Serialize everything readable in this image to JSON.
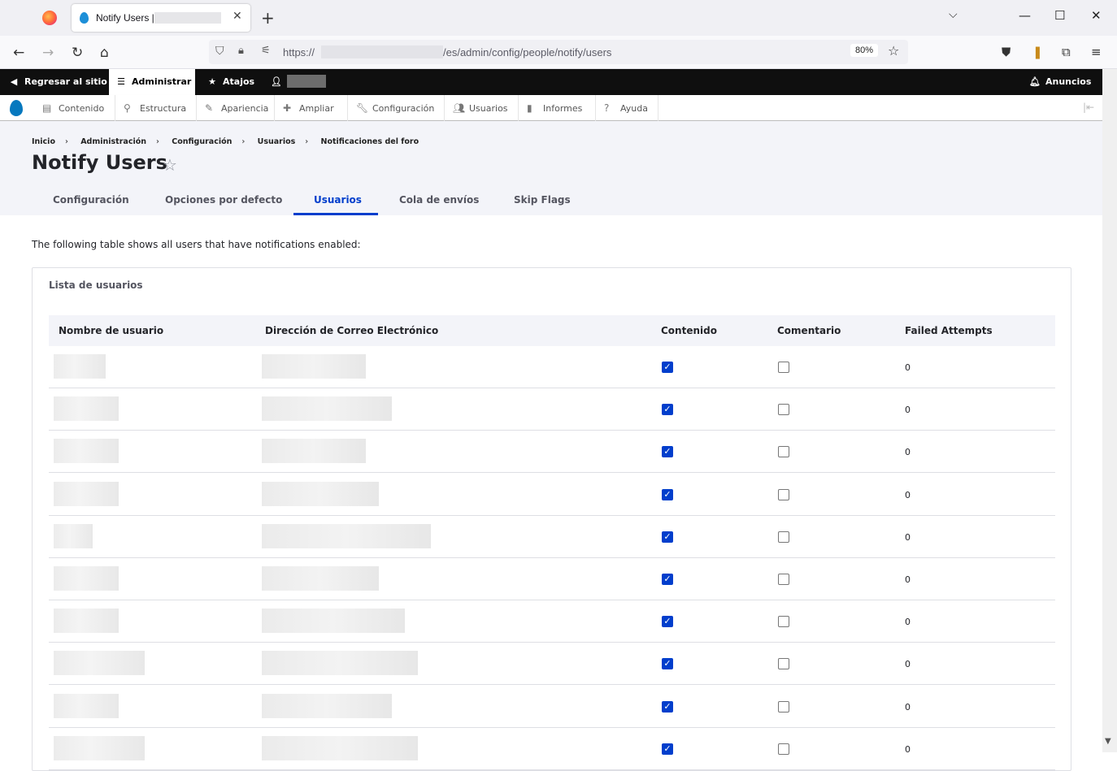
{
  "browser": {
    "tab_title": "Notify Users |",
    "new_tab": "+",
    "url_prefix": "https://",
    "url_path": "/es/admin/config/people/notify/users",
    "zoom": "80%"
  },
  "toolbar": {
    "back_site": "Regresar al sitio",
    "manage": "Administrar",
    "shortcuts": "Atajos",
    "announcements": "Anuncios"
  },
  "tray": {
    "items": [
      "Contenido",
      "Estructura",
      "Apariencia",
      "Ampliar",
      "Configuración",
      "Usuarios",
      "Informes",
      "Ayuda"
    ]
  },
  "breadcrumb": [
    "Inicio",
    "Administración",
    "Configuración",
    "Usuarios",
    "Notificaciones del foro"
  ],
  "page_title": "Notify Users",
  "tabs": [
    "Configuración",
    "Opciones por defecto",
    "Usuarios",
    "Cola de envíos",
    "Skip Flags"
  ],
  "intro": "The following table shows all users that have notifications enabled:",
  "panel_title": "Lista de usuarios",
  "table": {
    "headers": [
      "Nombre de usuario",
      "Dirección de Correo Electrónico",
      "Contenido",
      "Comentario",
      "Failed Attempts"
    ],
    "rows": [
      {
        "contenido": true,
        "comentario": false,
        "failed": "0"
      },
      {
        "contenido": true,
        "comentario": false,
        "failed": "0"
      },
      {
        "contenido": true,
        "comentario": false,
        "failed": "0"
      },
      {
        "contenido": true,
        "comentario": false,
        "failed": "0"
      },
      {
        "contenido": true,
        "comentario": false,
        "failed": "0"
      },
      {
        "contenido": true,
        "comentario": false,
        "failed": "0"
      },
      {
        "contenido": true,
        "comentario": false,
        "failed": "0"
      },
      {
        "contenido": true,
        "comentario": false,
        "failed": "0"
      },
      {
        "contenido": true,
        "comentario": false,
        "failed": "0"
      },
      {
        "contenido": true,
        "comentario": false,
        "failed": "0"
      }
    ]
  },
  "colors": {
    "accent": "#003ecc",
    "toolbar": "#0f0f0f",
    "header_bg": "#f3f4f9"
  }
}
